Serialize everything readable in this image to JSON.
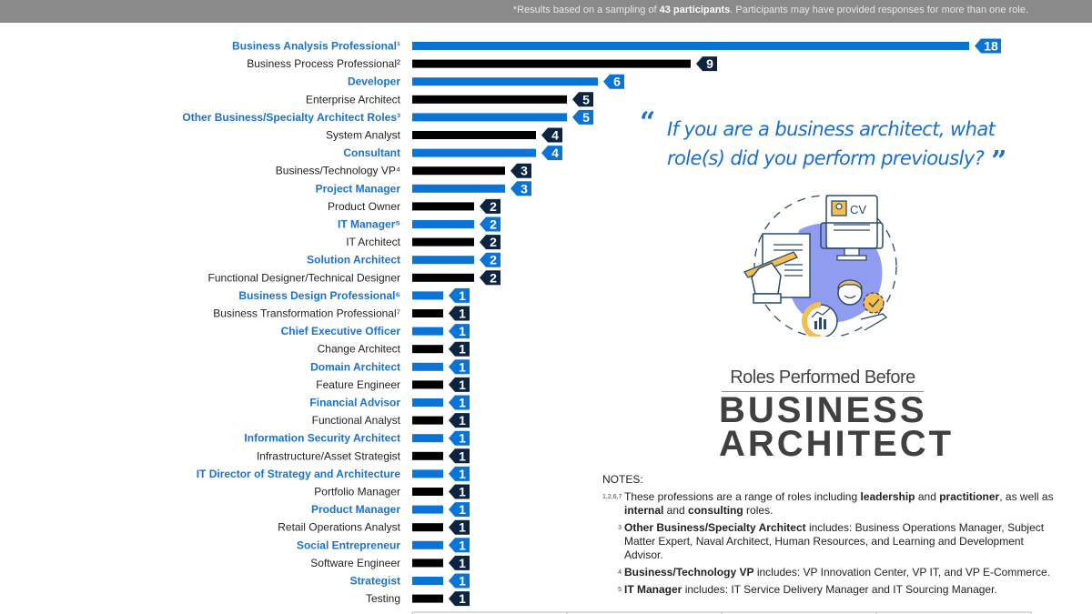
{
  "header": {
    "note_prefix": "*Results based on a sampling of ",
    "note_bold": "43 participants",
    "note_suffix": ". Participants may have provided responses for more than one role."
  },
  "quote": {
    "text": "If you are a business architect, what role(s) did you perform previously?",
    "open_mark": "“",
    "close_mark": "”"
  },
  "title": {
    "subtitle": "Roles Performed Before",
    "line1": "BUSINESS",
    "line2": "ARCHITECT"
  },
  "illustration": {
    "cv_label": "CV",
    "icons": [
      "document-pen-icon",
      "monitor-cv-icon",
      "person-gear-icon",
      "chart-gauge-icon"
    ]
  },
  "colors": {
    "blue": "#0a74d6",
    "black": "#000000",
    "badge_dark": "#0d2440",
    "badge_blue": "#0a74d6",
    "blue_label": "#1a73c9",
    "illus_blob": "#8f9cf0",
    "illus_accent": "#f5be4f",
    "illus_line": "#2b4a6b"
  },
  "notes": {
    "heading": "NOTES:",
    "items": [
      {
        "ref": "1,2,6,7",
        "parts": [
          [
            "These professions are a range of roles including ",
            false
          ],
          [
            "leadership",
            true
          ],
          [
            " and ",
            false
          ],
          [
            "practitioner",
            true
          ],
          [
            ", as well as ",
            false
          ],
          [
            "internal",
            true
          ],
          [
            " and ",
            false
          ],
          [
            "consulting",
            true
          ],
          [
            " roles.",
            false
          ]
        ]
      },
      {
        "ref": "3",
        "parts": [
          [
            "Other Business/Specialty Architect",
            true
          ],
          [
            " includes: Business Operations Manager, Subject Matter Expert, Naval Architect, Human Resources, and Learning and Development Advisor.",
            false
          ]
        ]
      },
      {
        "ref": "4",
        "parts": [
          [
            "Business/Technology VP",
            true
          ],
          [
            " includes: VP Innovation Center, VP IT, and VP E-Commerce.",
            false
          ]
        ]
      },
      {
        "ref": "5",
        "parts": [
          [
            "IT Manager",
            true
          ],
          [
            " includes: IT Service Delivery Manager and IT Sourcing Manager.",
            false
          ]
        ]
      }
    ]
  },
  "chart_data": {
    "type": "bar",
    "orientation": "horizontal",
    "title": "Roles Performed Before Business Architect",
    "xlabel": "",
    "ylabel": "",
    "xlim": [
      0,
      20
    ],
    "x_ticks": [
      0,
      5,
      10,
      15,
      20
    ],
    "grid": false,
    "data_labels": true,
    "categories": [
      "Business Analysis Professional¹",
      "Business Process Professional²",
      "Developer",
      "Enterprise Architect",
      "Other Business/Specialty Architect Roles³",
      "System Analyst",
      "Consultant",
      "Business/Technology VP⁴",
      "Project Manager",
      "Product Owner",
      "IT Manager⁵",
      "IT Architect",
      "Solution Architect",
      "Functional Designer/Technical Designer",
      "Business Design Professional⁶",
      "Business Transformation Professional⁷",
      "Chief Executive Officer",
      "Change Architect",
      "Domain Architect",
      "Feature Engineer",
      "Financial Advisor",
      "Functional Analyst",
      "Information Security Architect",
      "Infrastructure/Asset Strategist",
      "IT Director of Strategy and Architecture",
      "Portfolio Manager",
      "Product Manager",
      "Retail Operations Analyst",
      "Social Entrepreneur",
      "Software Engineer",
      "Strategist",
      "Testing"
    ],
    "values": [
      18,
      9,
      6,
      5,
      5,
      4,
      4,
      3,
      3,
      2,
      2,
      2,
      2,
      2,
      1,
      1,
      1,
      1,
      1,
      1,
      1,
      1,
      1,
      1,
      1,
      1,
      1,
      1,
      1,
      1,
      1,
      1
    ],
    "bar_colors": [
      "blue",
      "black",
      "blue",
      "black",
      "blue",
      "black",
      "blue",
      "black",
      "blue",
      "black",
      "blue",
      "black",
      "blue",
      "black",
      "blue",
      "black",
      "blue",
      "black",
      "blue",
      "black",
      "blue",
      "black",
      "blue",
      "black",
      "blue",
      "black",
      "blue",
      "black",
      "blue",
      "black",
      "blue",
      "black"
    ]
  }
}
